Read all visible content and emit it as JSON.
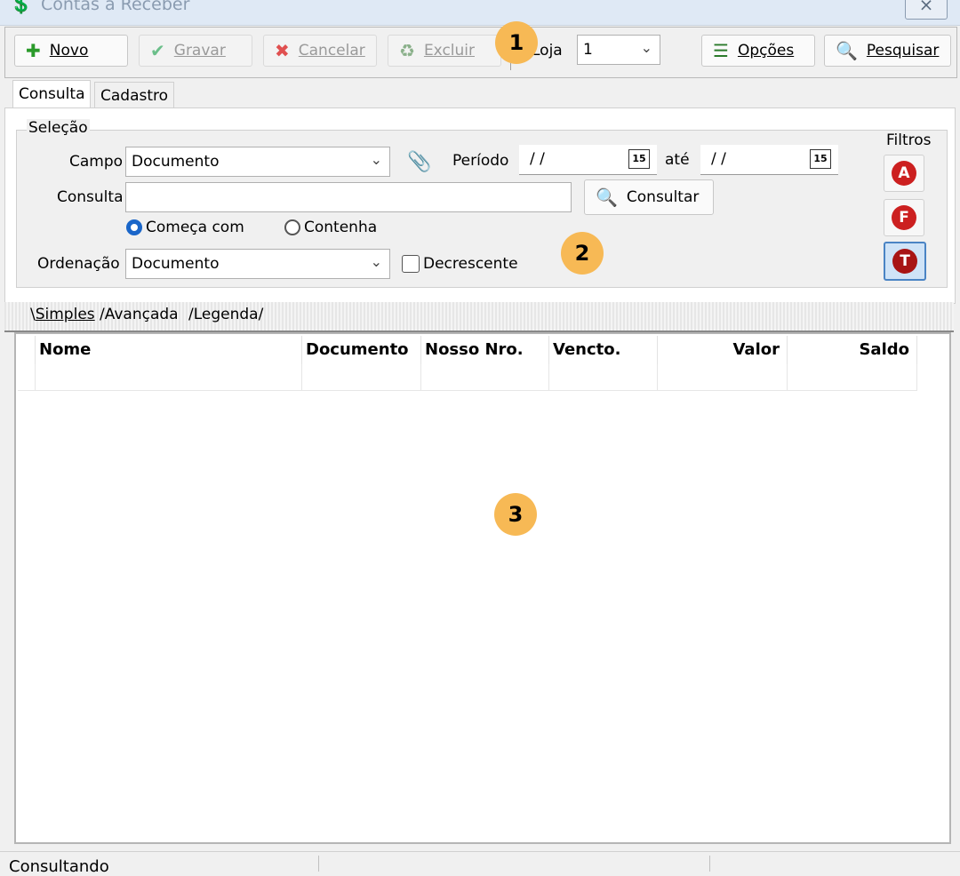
{
  "window": {
    "title": "Contas a Receber",
    "close_glyph": "⨯"
  },
  "toolbar": {
    "novo_label": "Novo",
    "gravar_label": "Gravar",
    "cancelar_label": "Cancelar",
    "excluir_label": "Excluir",
    "loja_label": "Loja",
    "loja_value": "1",
    "opcoes_label": "Opções",
    "pesquisar_label": "Pesquisar"
  },
  "tabs": [
    "Consulta",
    "Cadastro"
  ],
  "selecao": {
    "group_label": "Seleção",
    "campo_label": "Campo",
    "campo_value": "Documento",
    "periodo_label": "Período",
    "periodo_from": "/ /",
    "ate_label": "até",
    "periodo_to": "/ /",
    "calendar_glyph": "15",
    "consulta_label": "Consulta",
    "consulta_value": "",
    "consultar_button": "Consultar",
    "radio_comeca": "Começa com",
    "radio_contenha": "Contenha",
    "ordenacao_label": "Ordenação",
    "ordenacao_value": "Documento",
    "decrescente_label": "Decrescente",
    "filtros_label": "Filtros",
    "filtros": [
      "A",
      "F",
      "T"
    ]
  },
  "subtabs": [
    "Simples",
    "Avançada",
    "Legenda"
  ],
  "grid": {
    "columns": [
      "Nome",
      "Documento",
      "Nosso Nro.",
      "Vencto.",
      "Valor",
      "Saldo"
    ]
  },
  "badges": [
    "1",
    "2",
    "3"
  ],
  "status": {
    "text": "Consultando"
  },
  "colors": {
    "accent": "#1a66c9",
    "badge": "#f7b955",
    "filter_red": "#cc2020"
  }
}
